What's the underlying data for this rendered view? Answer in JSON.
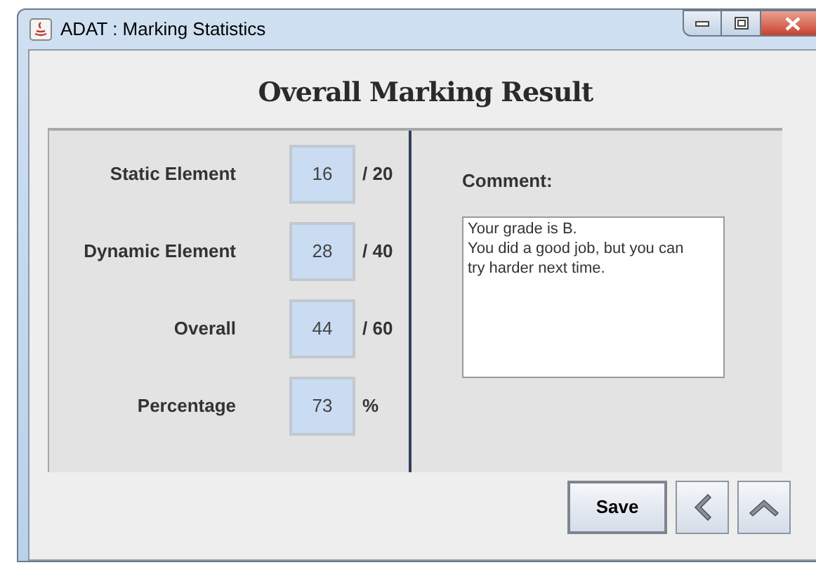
{
  "window": {
    "title": "ADAT : Marking Statistics"
  },
  "heading": "Overall Marking Result",
  "scores": [
    {
      "label": "Static Element",
      "value": "16",
      "suffix": "/ 20"
    },
    {
      "label": "Dynamic Element",
      "value": "28",
      "suffix": "/ 40"
    },
    {
      "label": "Overall",
      "value": "44",
      "suffix": "/ 60"
    },
    {
      "label": "Percentage",
      "value": "73",
      "suffix": "%"
    }
  ],
  "comment": {
    "label": "Comment:",
    "lines": [
      "Your grade is B.",
      "You did a good job, but you can",
      "try harder next time."
    ]
  },
  "buttons": [
    {
      "kind": "text",
      "label": "Save"
    },
    {
      "kind": "back"
    },
    {
      "kind": "up"
    }
  ]
}
